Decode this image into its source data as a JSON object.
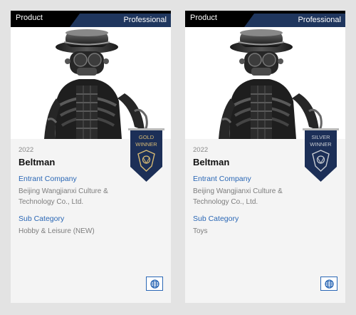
{
  "cards": [
    {
      "type_label": "Product",
      "level_label": "Professional",
      "year": "2022",
      "title": "Beltman",
      "company_label": "Entrant Company",
      "company": "Beijing Wangjianxi Culture & Technology Co., Ltd.",
      "category_label": "Sub Category",
      "category": "Hobby & Leisure (NEW)",
      "award_line1": "GOLD",
      "award_line2": "WINNER",
      "award_text_color": "#d8bb74",
      "website_icon": "globe-icon"
    },
    {
      "type_label": "Product",
      "level_label": "Professional",
      "year": "2022",
      "title": "Beltman",
      "company_label": "Entrant Company",
      "company": "Beijing Wangjianxi Culture & Technology Co., Ltd.",
      "category_label": "Sub Category",
      "category": "Toys",
      "award_line1": "SILVER",
      "award_line2": "WINNER",
      "award_text_color": "#c8ccd2",
      "website_icon": "globe-icon"
    }
  ],
  "colors": {
    "header_black": "#000000",
    "header_navy": "#1f365e",
    "link_blue": "#2a67b5",
    "pennant_navy": "#1c2f57"
  }
}
